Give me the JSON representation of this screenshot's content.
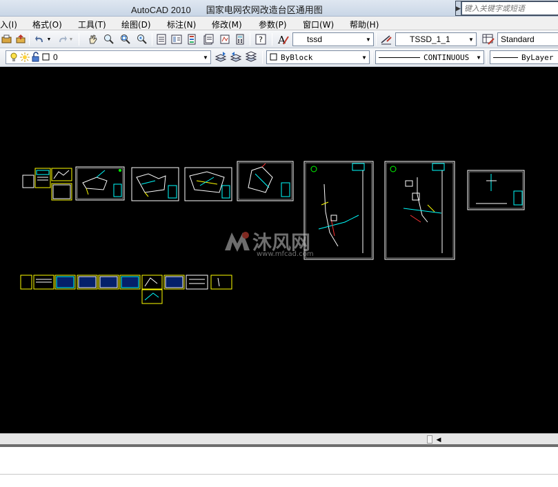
{
  "window": {
    "app_title": "AutoCAD 2010",
    "doc_title": "国家电网农网改造台区通用图",
    "help_search_placeholder": "键入关键字或短语"
  },
  "menu": [
    "入(I)",
    "格式(O)",
    "工具(T)",
    "绘图(D)",
    "标注(N)",
    "修改(M)",
    "参数(P)",
    "窗口(W)",
    "帮助(H)"
  ],
  "toolbar1": {
    "text_style": "tssd",
    "dim_style": "TSSD_1_1",
    "table_style": "Standard"
  },
  "toolbar2": {
    "layer": "0",
    "color": "ByBlock",
    "linetype": "CONTINUOUS",
    "lineweight": "ByLayer"
  },
  "watermark": {
    "brand": "沐风网",
    "url": "www.mfcad.com"
  },
  "colors": {
    "canvas": "#000000",
    "sheet_border": "#ffffff",
    "thumb_border": "#ffff00",
    "accent_cyan": "#00ffff",
    "accent_yellow": "#ffff00"
  },
  "icons": [
    "plot-preview-icon",
    "publish-icon",
    "undo-icon",
    "redo-icon",
    "pan-icon",
    "zoom-realtime-icon",
    "zoom-window-icon",
    "zoom-previous-icon",
    "properties-icon",
    "design-center-icon",
    "tool-palettes-icon",
    "sheet-set-icon",
    "markup-icon",
    "calculator-icon",
    "help-icon",
    "text-style-icon",
    "dim-style-icon",
    "table-style-icon",
    "layer-on-icon",
    "layer-freeze-icon",
    "layer-lock-icon",
    "layer-color-icon",
    "make-current-icon",
    "layer-previous-icon",
    "layer-states-icon"
  ]
}
